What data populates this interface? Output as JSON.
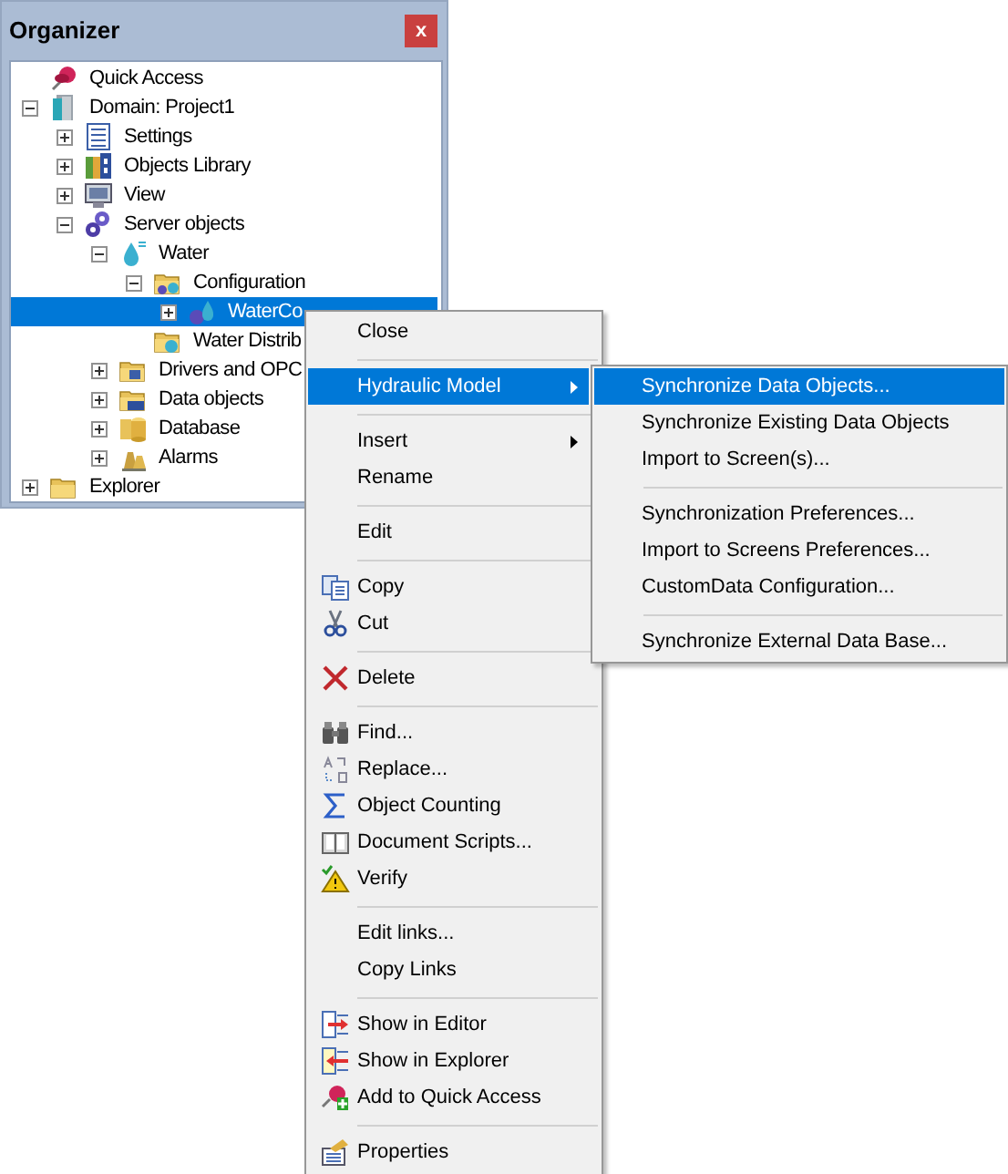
{
  "organizer": {
    "title": "Organizer",
    "close_label": "x",
    "tree": [
      {
        "label": "Quick Access",
        "selected": false
      },
      {
        "label": "Domain: Project1",
        "selected": false,
        "expanded": true,
        "children": [
          {
            "label": "Settings",
            "selected": false,
            "expanded": false
          },
          {
            "label": "Objects Library",
            "selected": false,
            "expanded": false
          },
          {
            "label": "View",
            "selected": false,
            "expanded": false
          },
          {
            "label": "Server objects",
            "selected": false,
            "expanded": true,
            "children": [
              {
                "label": "Water",
                "selected": false,
                "expanded": true,
                "children": [
                  {
                    "label": "Configuration",
                    "selected": false,
                    "expanded": true,
                    "children": [
                      {
                        "label": "WaterCo",
                        "selected": true,
                        "expanded": false
                      }
                    ]
                  },
                  {
                    "label": "Water Distrib",
                    "selected": false
                  }
                ]
              },
              {
                "label": "Drivers and OPC",
                "selected": false,
                "expanded": false
              },
              {
                "label": "Data objects",
                "selected": false,
                "expanded": false
              },
              {
                "label": "Database",
                "selected": false,
                "expanded": false
              },
              {
                "label": "Alarms",
                "selected": false,
                "expanded": false
              }
            ]
          }
        ]
      },
      {
        "label": "Explorer",
        "selected": false,
        "expanded": false
      }
    ]
  },
  "context_menu": {
    "groups": [
      [
        {
          "label": "Close",
          "selected": false,
          "submenu": false
        }
      ],
      [
        {
          "label": "Hydraulic Model",
          "selected": true,
          "submenu": true
        }
      ],
      [
        {
          "label": "Insert",
          "selected": false,
          "submenu": true
        },
        {
          "label": "Rename",
          "selected": false,
          "submenu": false
        }
      ],
      [
        {
          "label": "Edit",
          "selected": false,
          "submenu": false
        }
      ],
      [
        {
          "label": "Copy",
          "selected": false,
          "submenu": false
        },
        {
          "label": "Cut",
          "selected": false,
          "submenu": false
        }
      ],
      [
        {
          "label": "Delete",
          "selected": false,
          "submenu": false
        }
      ],
      [
        {
          "label": "Find...",
          "selected": false,
          "submenu": false
        },
        {
          "label": "Replace...",
          "selected": false,
          "submenu": false
        },
        {
          "label": "Object Counting",
          "selected": false,
          "submenu": false
        },
        {
          "label": "Document Scripts...",
          "selected": false,
          "submenu": false
        },
        {
          "label": "Verify",
          "selected": false,
          "submenu": false
        }
      ],
      [
        {
          "label": "Edit links...",
          "selected": false,
          "submenu": false
        },
        {
          "label": "Copy Links",
          "selected": false,
          "submenu": false
        }
      ],
      [
        {
          "label": "Show in Editor",
          "selected": false,
          "submenu": false
        },
        {
          "label": "Show in Explorer",
          "selected": false,
          "submenu": false
        },
        {
          "label": "Add to Quick Access",
          "selected": false,
          "submenu": false
        }
      ],
      [
        {
          "label": "Properties",
          "selected": false,
          "submenu": false
        }
      ]
    ]
  },
  "submenu": {
    "groups": [
      [
        {
          "label": "Synchronize Data Objects...",
          "selected": true
        },
        {
          "label": "Synchronize Existing Data Objects",
          "selected": false
        },
        {
          "label": "Import to Screen(s)...",
          "selected": false
        }
      ],
      [
        {
          "label": "Synchronization Preferences...",
          "selected": false
        },
        {
          "label": "Import to Screens Preferences...",
          "selected": false
        },
        {
          "label": "CustomData Configuration...",
          "selected": false
        }
      ],
      [
        {
          "label": "Synchronize External Data Base...",
          "selected": false
        }
      ]
    ]
  }
}
